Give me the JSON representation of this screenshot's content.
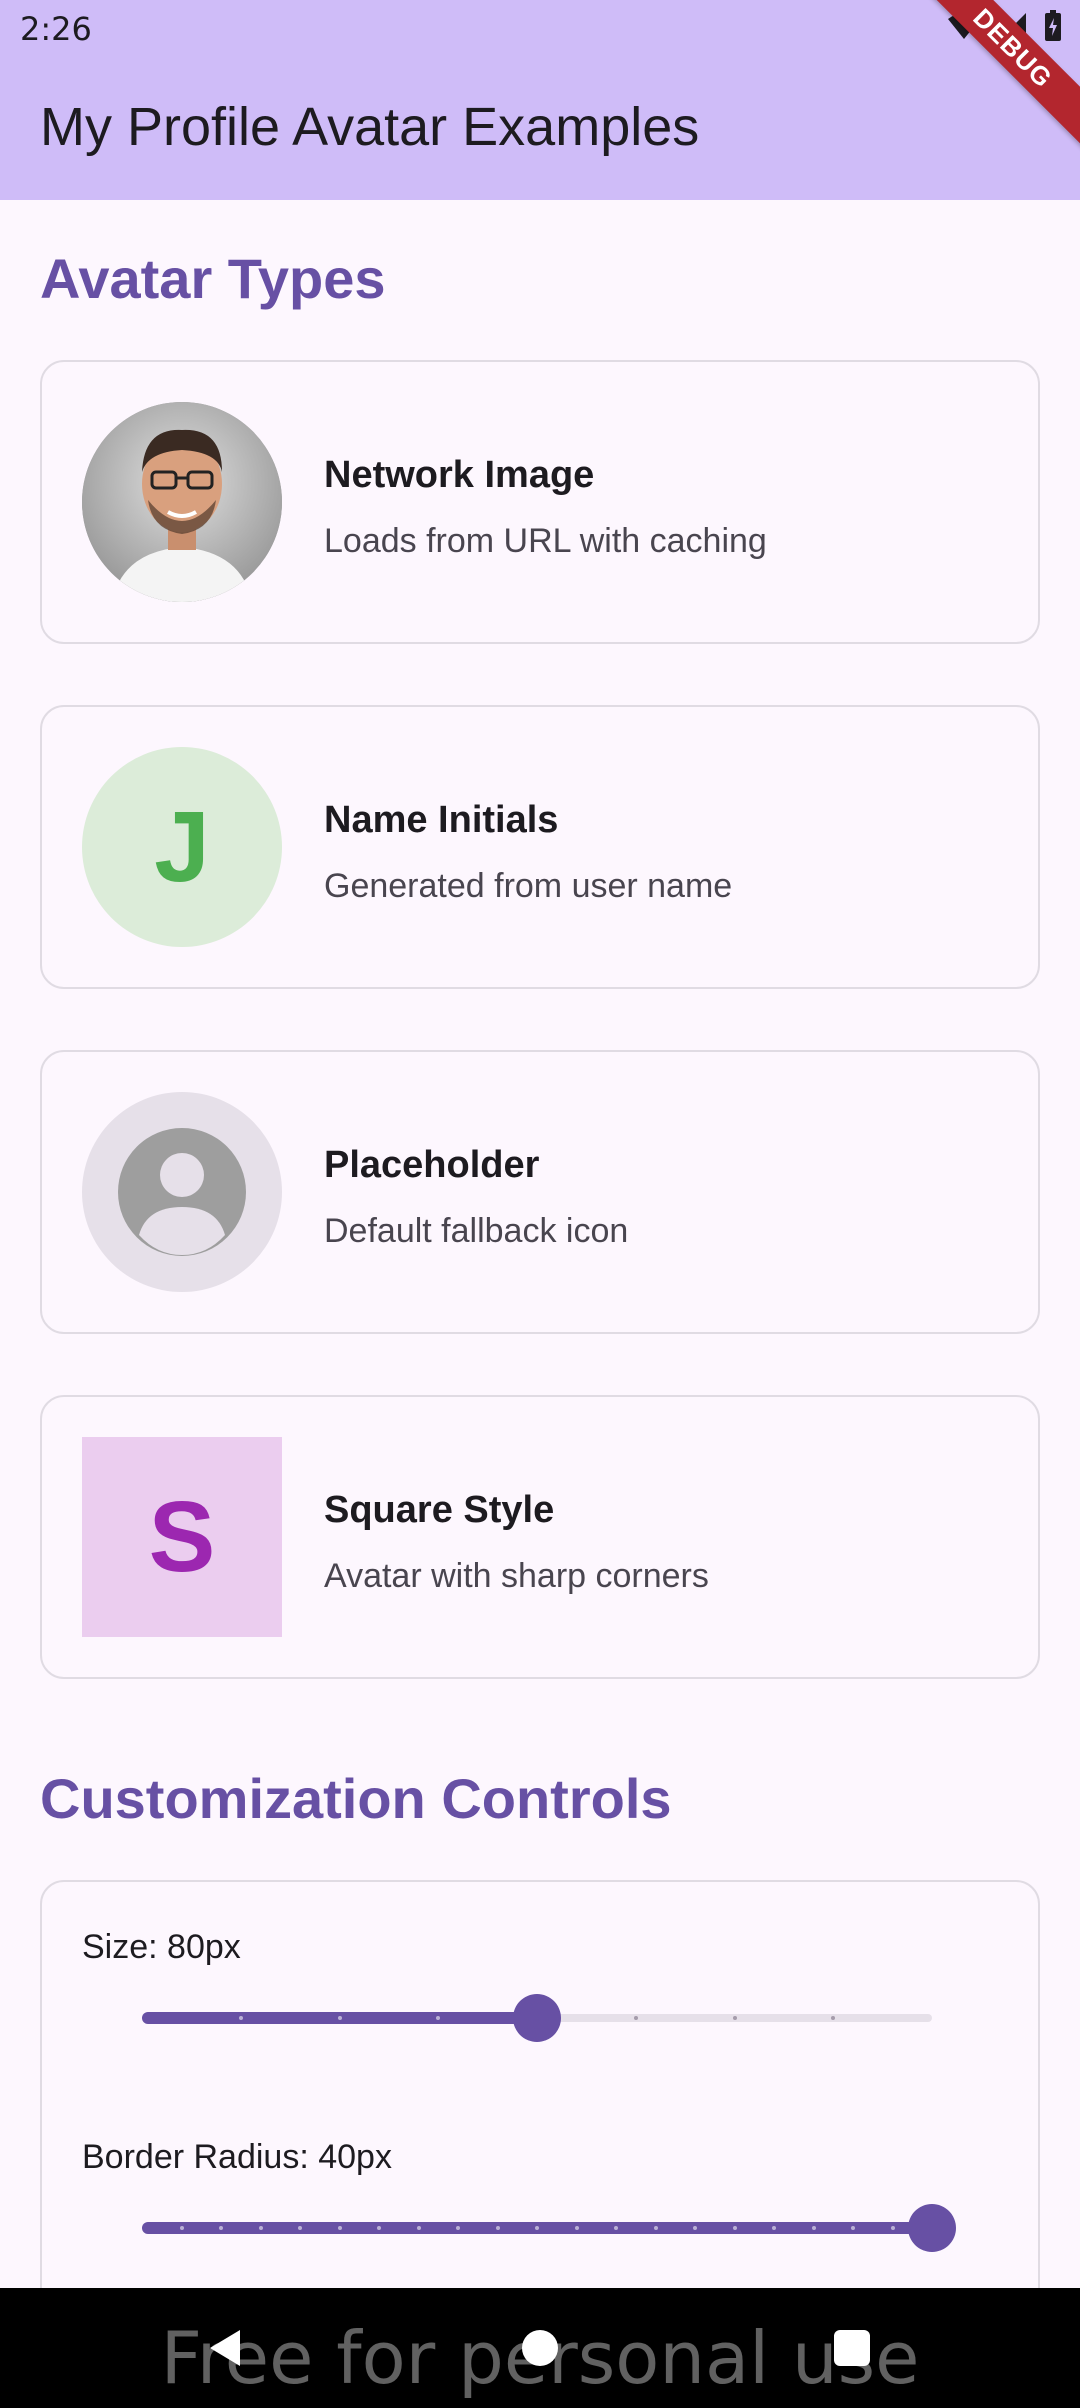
{
  "status_bar": {
    "time": "2:26"
  },
  "debug_banner": "DEBUG",
  "app_bar": {
    "title": "My Profile Avatar Examples"
  },
  "sections": {
    "avatar_types_title": "Avatar Types",
    "customization_title": "Customization Controls"
  },
  "cards": [
    {
      "title": "Network Image",
      "subtitle": "Loads from URL with caching",
      "avatar_type": "photo-icon"
    },
    {
      "title": "Name Initials",
      "subtitle": "Generated from user name",
      "initial": "J",
      "bg": "#dcecd9",
      "fg": "#4caf50"
    },
    {
      "title": "Placeholder",
      "subtitle": "Default fallback icon",
      "avatar_type": "person-icon",
      "bg": "#e6e0e9",
      "fg": "#9e9e9e"
    },
    {
      "title": "Square Style",
      "subtitle": "Avatar with sharp corners",
      "initial": "S",
      "bg": "#ebcdef",
      "fg": "#9c27b0"
    }
  ],
  "controls": {
    "size_label": "Size: 80px",
    "size_fraction": 0.5,
    "radius_label": "Border Radius: 40px",
    "radius_fraction": 1.0
  },
  "colors": {
    "accent": "#6750a4",
    "app_bar": "#cfbcf8",
    "background": "#fdf7fe"
  },
  "watermark": "Free for personal use"
}
